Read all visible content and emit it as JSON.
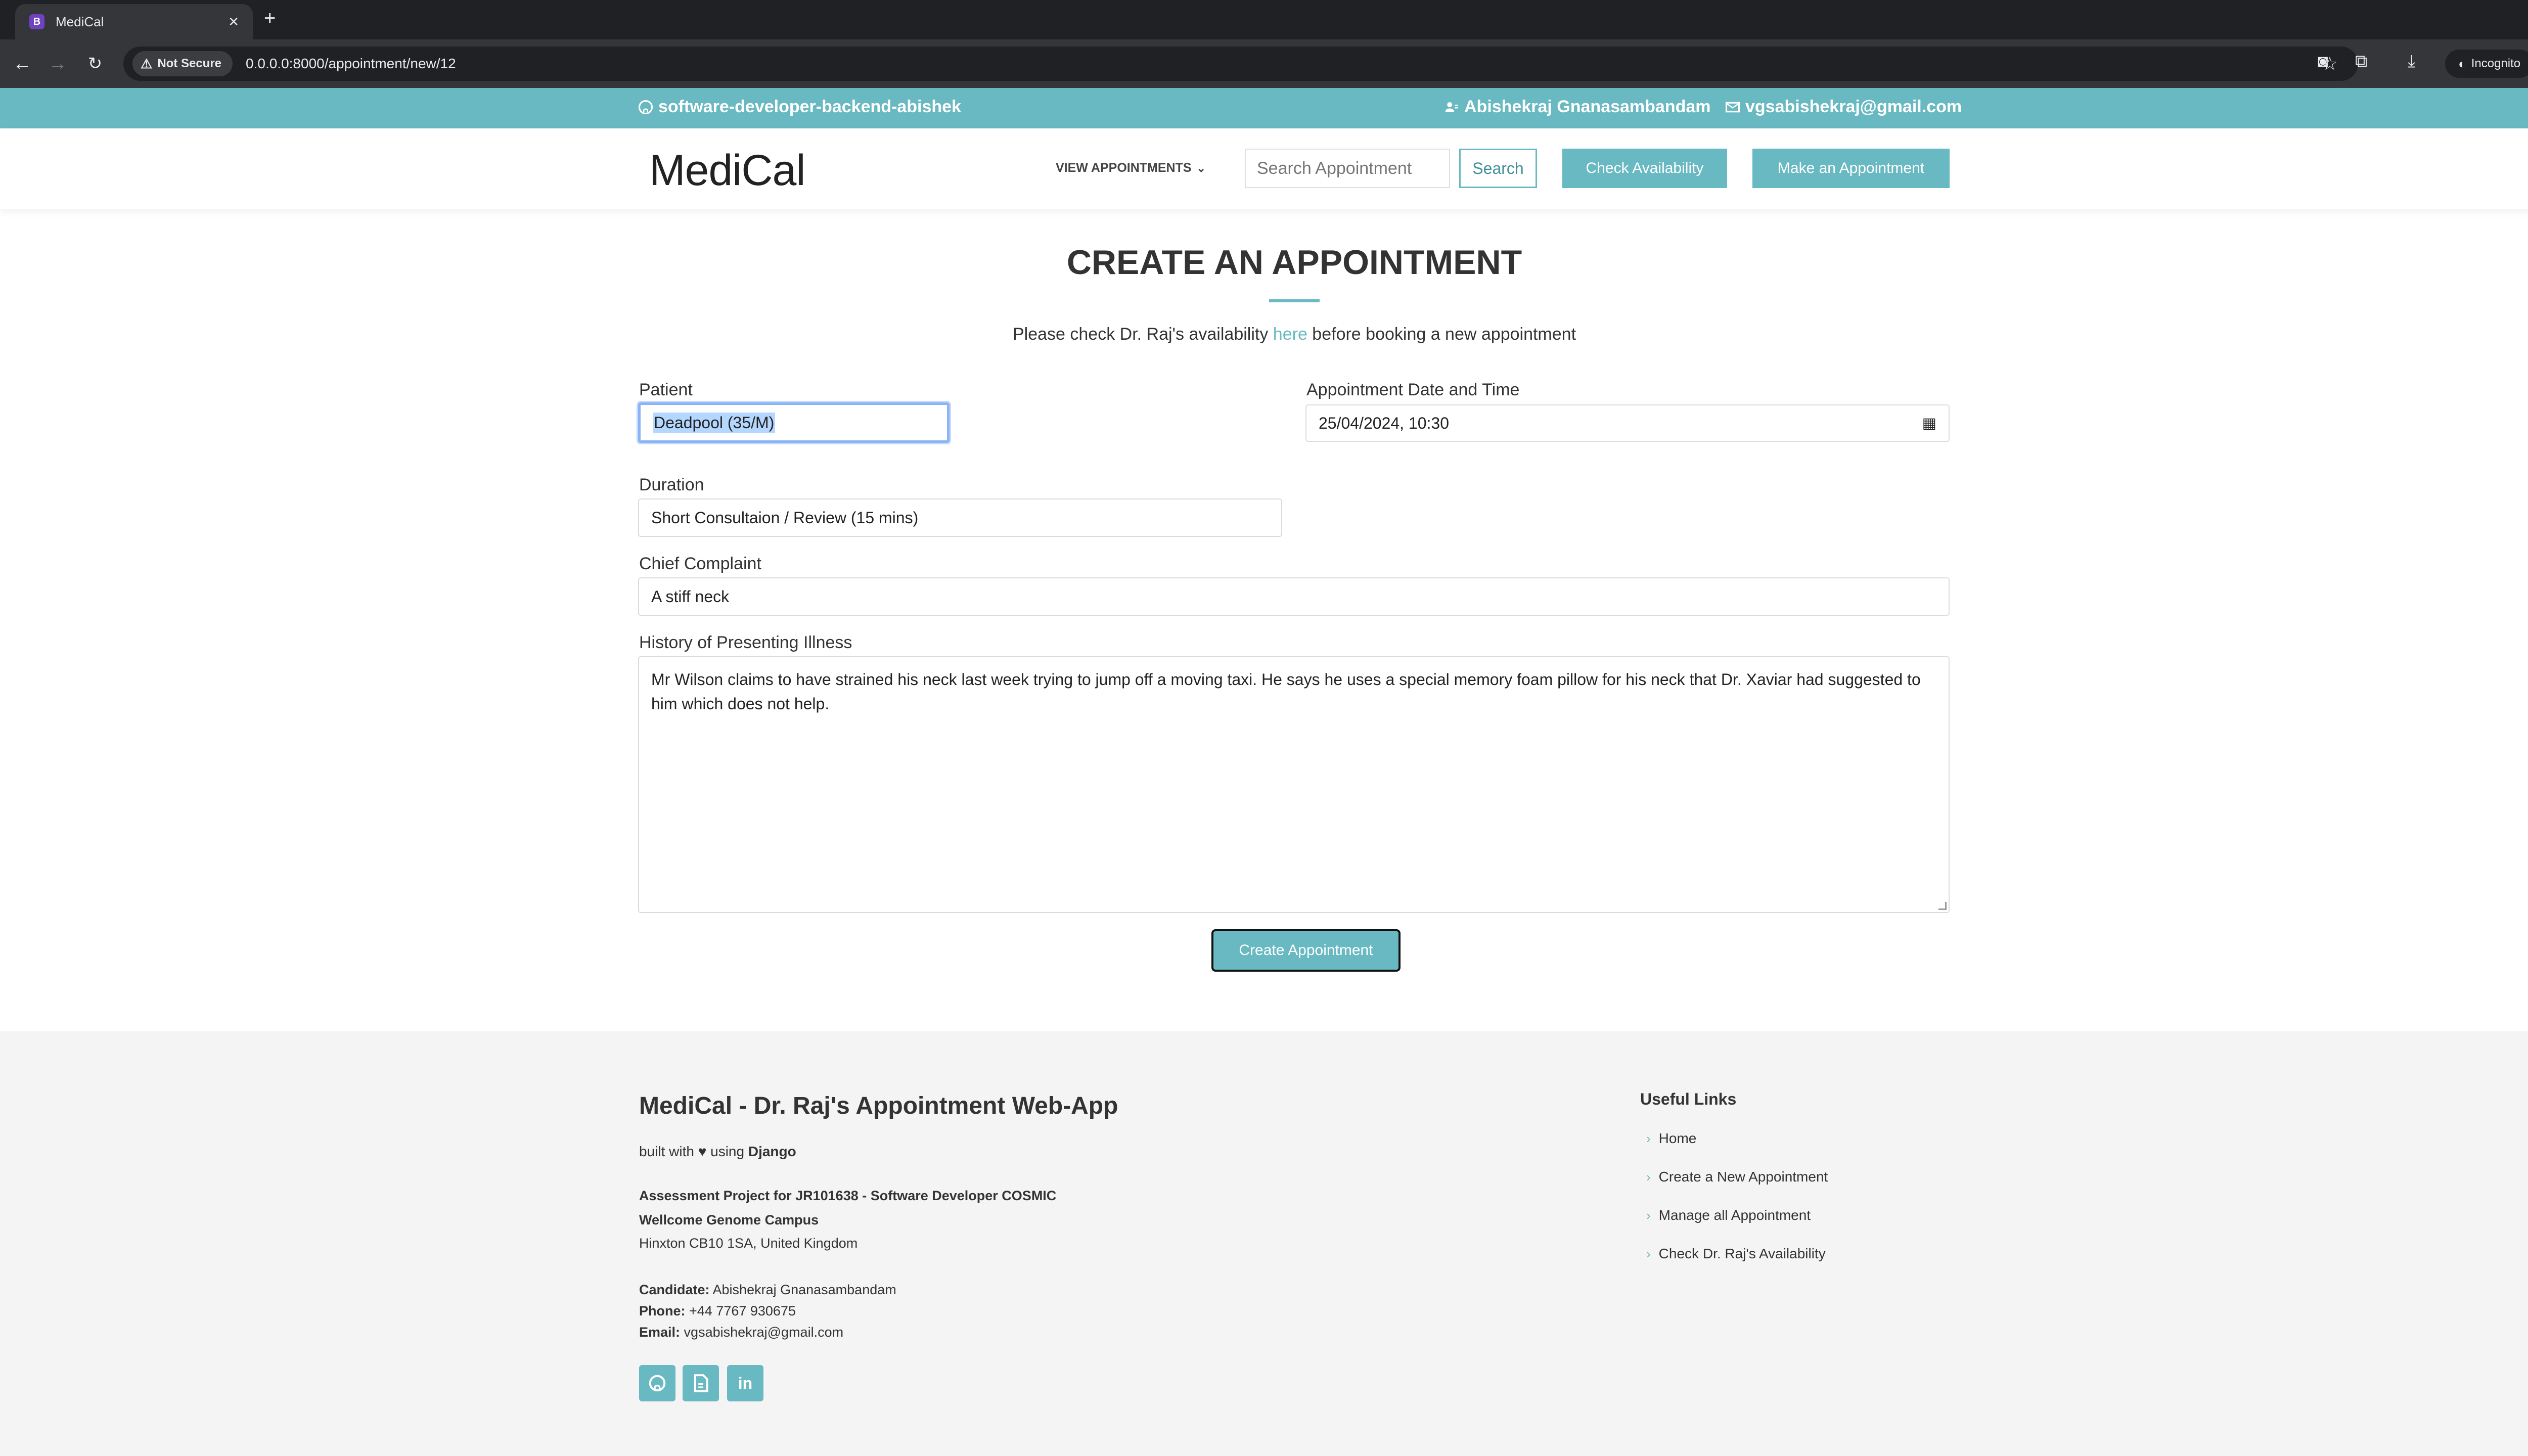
{
  "browser": {
    "tab_title": "MediCal",
    "favicon_letter": "B",
    "security_label": "Not Secure",
    "url": "0.0.0.0:8000/appointment/new/12",
    "incognito_label": "Incognito"
  },
  "topbar": {
    "github": "software-developer-backend-abishek",
    "user": "Abishekraj Gnanasambandam",
    "email": "vgsabishekraj@gmail.com"
  },
  "header": {
    "logo": "MediCal",
    "view_appointments": "VIEW APPOINTMENTS",
    "search_placeholder": "Search Appointment",
    "search_button": "Search",
    "check_availability": "Check Availability",
    "make_appointment": "Make an Appointment"
  },
  "main": {
    "title": "CREATE AN APPOINTMENT",
    "notice_before": "Please check Dr. Raj's availability ",
    "notice_link": "here",
    "notice_after": " before booking a new appointment",
    "patient_label": "Patient",
    "patient_value": "Deadpool (35/M)",
    "datetime_label": "Appointment Date and Time",
    "datetime_value": "25/04/2024, 10:30",
    "duration_label": "Duration",
    "duration_value": "Short Consultaion / Review (15 mins)",
    "complaint_label": "Chief Complaint",
    "complaint_value": "A stiff neck",
    "history_label": "History of Presenting Illness",
    "history_value": "Mr Wilson claims to have strained his neck last week trying to jump off a moving taxi. He says he uses a special memory foam pillow for his neck that Dr. Xaviar had suggested to him which does not help.",
    "submit_button": "Create Appointment"
  },
  "footer": {
    "title": "MediCal - Dr. Raj's Appointment Web-App",
    "built_prefix": "built with",
    "built_using": "using",
    "built_framework": "Django",
    "project_line": "Assessment Project for JR101638 - Software Developer COSMIC",
    "campus": "Wellcome Genome Campus",
    "address": "Hinxton CB10 1SA, United Kingdom",
    "candidate_label": "Candidate:",
    "candidate_value": "Abishekraj Gnanasambandam",
    "phone_label": "Phone:",
    "phone_value": "+44 7767 930675",
    "email_label": "Email:",
    "email_value": "vgsabishekraj@gmail.com",
    "social_linkedin": "in",
    "links_title": "Useful Links",
    "links": [
      "Home",
      "Create a New Appointment",
      "Manage all Appointment",
      "Check Dr. Raj's Availability"
    ]
  },
  "colors": {
    "accent": "#69b9c2",
    "footer_bg": "#f4f4f4"
  }
}
